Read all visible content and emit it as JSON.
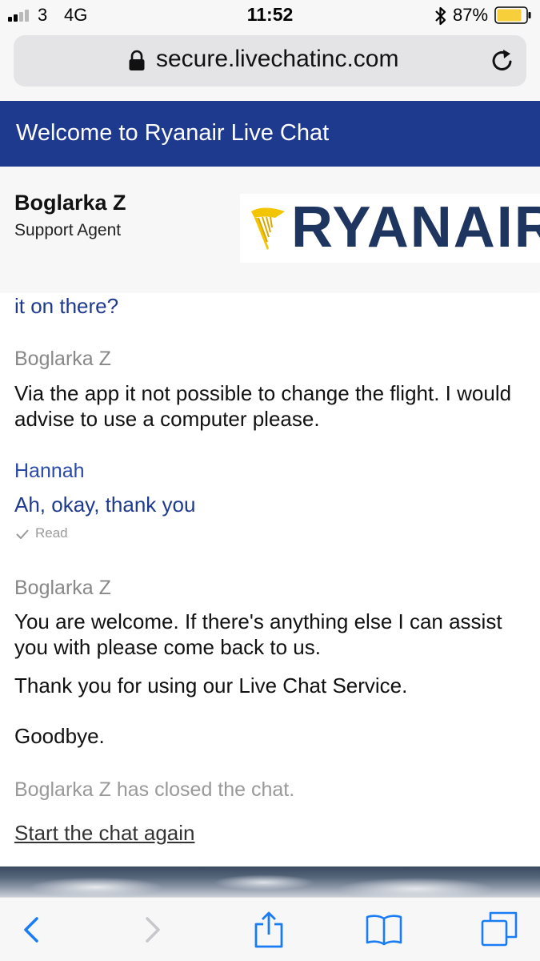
{
  "status_bar": {
    "carrier": "3",
    "network": "4G",
    "time": "11:52",
    "battery": "87%",
    "signal_bars_filled": 2,
    "battery_level": 0.87
  },
  "browser": {
    "url": "secure.livechatinc.com"
  },
  "chat": {
    "header_title": "Welcome to Ryanair Live Chat",
    "agent": {
      "name": "Boglarka Z",
      "role": "Support Agent",
      "logo_text": "RYANAIR"
    },
    "messages": [
      {
        "kind": "user-fragment",
        "text": "it on there?"
      },
      {
        "kind": "sender-agent",
        "text": "Boglarka Z"
      },
      {
        "kind": "agent",
        "text": "Via the app it not possible to change the flight. I would advise to use a computer please."
      },
      {
        "kind": "sender-user",
        "text": "Hannah"
      },
      {
        "kind": "user",
        "text": "Ah, okay, thank you"
      },
      {
        "kind": "read",
        "text": "Read"
      },
      {
        "kind": "sender-agent",
        "text": "Boglarka Z"
      },
      {
        "kind": "agent",
        "text": "You are welcome. If there's anything else I can assist you with please come back to us."
      },
      {
        "kind": "agent",
        "text": "Thank you for using our Live Chat Service."
      },
      {
        "kind": "agent",
        "text": "Goodbye."
      }
    ],
    "closed_note": "Boglarka Z has closed the chat.",
    "restart_link": "Start the chat again"
  },
  "colors": {
    "header_bg": "#1e3a8f",
    "user_text": "#1e3a8f",
    "ios_blue": "#1a7cf5",
    "logo_navy": "#1e3560",
    "logo_gold": "#f2c500"
  },
  "icons": {
    "signal": "signal-bars-icon",
    "bluetooth": "bluetooth-icon",
    "battery": "battery-icon",
    "lock": "lock-icon",
    "reload": "reload-icon",
    "harp": "ryanair-harp-icon",
    "check": "check-icon",
    "back": "back-arrow-icon",
    "forward": "forward-arrow-icon",
    "share": "share-icon",
    "bookmarks": "bookmarks-icon",
    "tabs": "tabs-icon"
  }
}
